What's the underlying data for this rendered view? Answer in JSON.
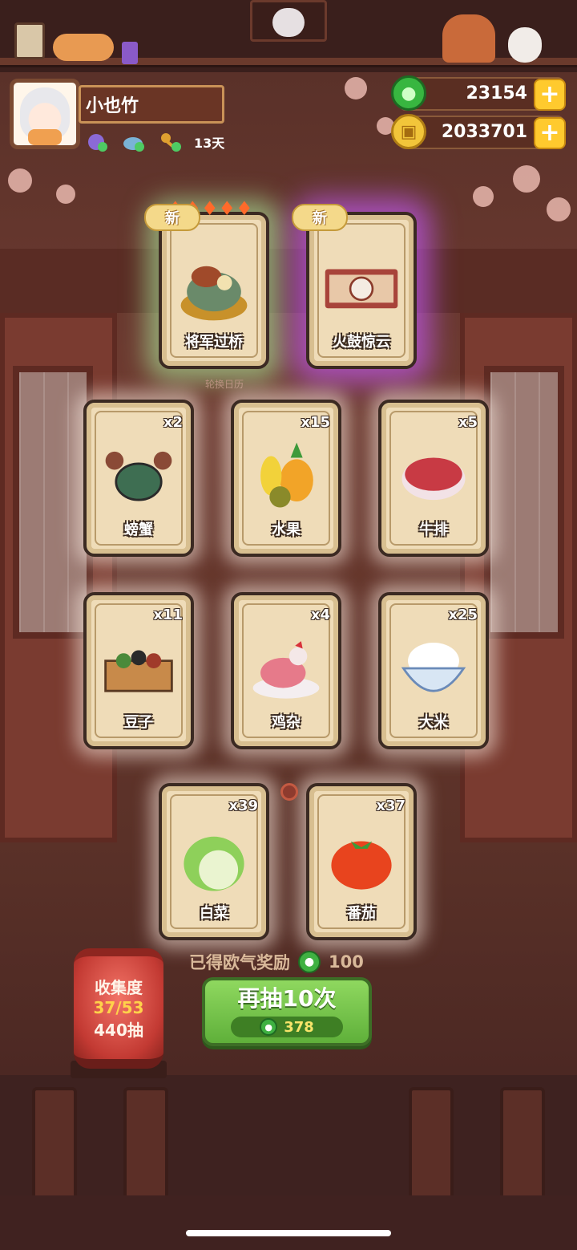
{
  "player": {
    "name": "小也竹",
    "days": "13天"
  },
  "currency": {
    "jade": "23154",
    "coins": "2033701"
  },
  "featured": [
    {
      "label": "将军过桥",
      "new_tag": "新"
    },
    {
      "label": "火鼓惊云",
      "new_tag": "新"
    }
  ],
  "calendar_hint": "轮换日历",
  "items": [
    {
      "label": "螃蟹",
      "qty": "x2"
    },
    {
      "label": "水果",
      "qty": "x15"
    },
    {
      "label": "牛排",
      "qty": "x5"
    },
    {
      "label": "豆子",
      "qty": "x11"
    },
    {
      "label": "鸡杂",
      "qty": "x4"
    },
    {
      "label": "大米",
      "qty": "x25"
    },
    {
      "label": "白菜",
      "qty": "x39"
    },
    {
      "label": "番茄",
      "qty": "x37"
    }
  ],
  "reward": {
    "text": "已得欧气奖励",
    "amount": "100"
  },
  "draw_button": {
    "label": "再抽10次",
    "cost": "378"
  },
  "collection": {
    "title": "收集度",
    "progress": "37/53",
    "draws": "440抽"
  }
}
